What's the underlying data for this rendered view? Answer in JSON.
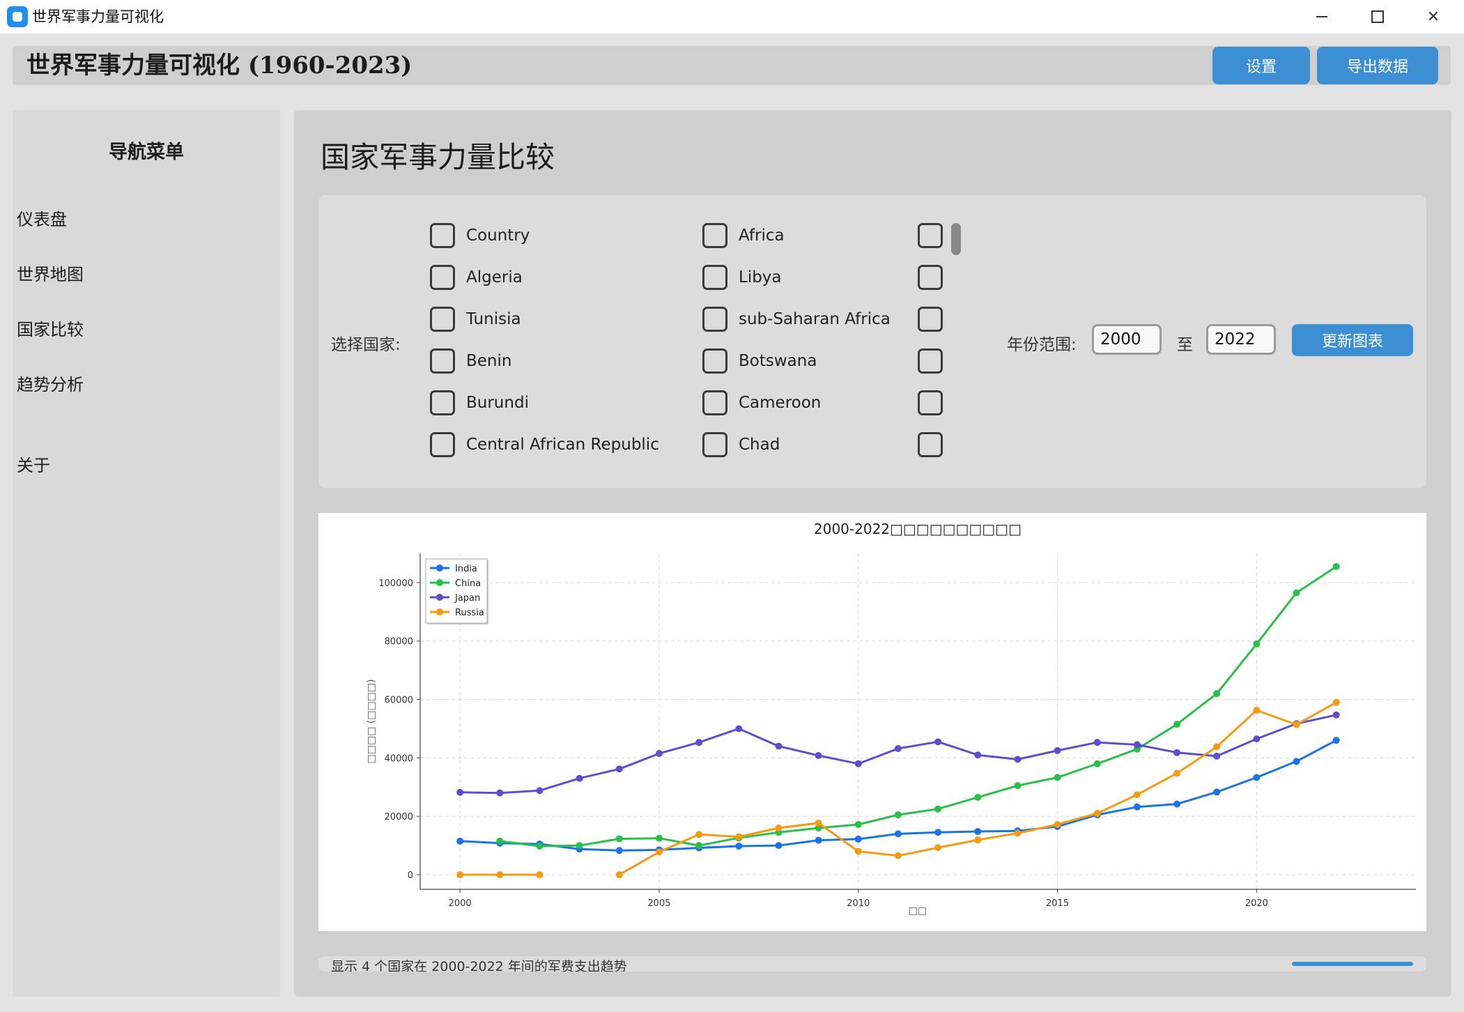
{
  "window": {
    "title": "世界军事力量可视化"
  },
  "header": {
    "title": "世界军事力量可视化 (1960-2023)",
    "settings_label": "设置",
    "export_label": "导出数据"
  },
  "sidebar": {
    "title": "导航菜单",
    "items": [
      {
        "label": "仪表盘"
      },
      {
        "label": "世界地图"
      },
      {
        "label": "国家比较"
      },
      {
        "label": "趋势分析"
      },
      {
        "label": "关于"
      }
    ]
  },
  "main": {
    "page_title": "国家军事力量比较",
    "select_label": "选择国家:",
    "countries_col1": [
      "Country",
      "Algeria",
      "Tunisia",
      "Benin",
      "Burundi",
      "Central African Republic"
    ],
    "countries_col2": [
      "Africa",
      "Libya",
      "sub-Saharan Africa",
      "Botswana",
      "Cameroon",
      "Chad"
    ],
    "countries_col3": [
      "",
      "",
      "",
      "",
      "",
      ""
    ],
    "year_label": "年份范围:",
    "year_from": "2000",
    "year_to_label": "至",
    "year_to": "2022",
    "update_label": "更新图表",
    "bottom_text": "显示 4 个国家在 2000-2022 年间的军费支出趋势",
    "progress": 1.0
  },
  "chart_data": {
    "type": "line",
    "title": "2000-2022□□□□□□□□□□",
    "xlabel": "□□",
    "ylabel": "□□□□ (□□□□)",
    "xlim": [
      1999.0,
      2024.0
    ],
    "ylim": [
      -5000,
      110000
    ],
    "xticks": [
      2000,
      2005,
      2010,
      2015,
      2020
    ],
    "yticks": [
      0,
      20000,
      40000,
      60000,
      80000,
      100000
    ],
    "grid": true,
    "legend": "top-left",
    "series": [
      {
        "name": "India",
        "color": "#1a73e8",
        "points": [
          [
            2000,
            11500
          ],
          [
            2001,
            10800
          ],
          [
            2002,
            10500
          ],
          [
            2003,
            8800
          ],
          [
            2004,
            8300
          ],
          [
            2005,
            8500
          ],
          [
            2006,
            9200
          ],
          [
            2007,
            9800
          ],
          [
            2008,
            10000
          ],
          [
            2009,
            11800
          ],
          [
            2010,
            12200
          ],
          [
            2011,
            14000
          ],
          [
            2012,
            14500
          ],
          [
            2013,
            14800
          ],
          [
            2014,
            15000
          ],
          [
            2015,
            16500
          ],
          [
            2016,
            20500
          ],
          [
            2017,
            23200
          ],
          [
            2018,
            24200
          ],
          [
            2019,
            28300
          ],
          [
            2020,
            33300
          ],
          [
            2021,
            38800
          ],
          [
            2022,
            46000
          ]
        ]
      },
      {
        "name": "China",
        "color": "#28c04a",
        "points": [
          [
            2001,
            11500
          ],
          [
            2002,
            9800
          ],
          [
            2003,
            10000
          ],
          [
            2004,
            12300
          ],
          [
            2005,
            12500
          ],
          [
            2006,
            10000
          ],
          [
            2007,
            12600
          ],
          [
            2008,
            14500
          ],
          [
            2009,
            16000
          ],
          [
            2010,
            17200
          ],
          [
            2011,
            20500
          ],
          [
            2012,
            22500
          ],
          [
            2013,
            26500
          ],
          [
            2014,
            30500
          ],
          [
            2015,
            33300
          ],
          [
            2016,
            38000
          ],
          [
            2017,
            43000
          ],
          [
            2018,
            51500
          ],
          [
            2019,
            62000
          ],
          [
            2020,
            79000
          ],
          [
            2021,
            96500
          ],
          [
            2022,
            105500
          ]
        ]
      },
      {
        "name": "Japan",
        "color": "#5b4fd0",
        "points": [
          [
            2000,
            28200
          ],
          [
            2001,
            28000
          ],
          [
            2002,
            28800
          ],
          [
            2003,
            33000
          ],
          [
            2004,
            36200
          ],
          [
            2005,
            41500
          ],
          [
            2006,
            45300
          ],
          [
            2007,
            50000
          ],
          [
            2008,
            44000
          ],
          [
            2009,
            40800
          ],
          [
            2010,
            38000
          ],
          [
            2011,
            43200
          ],
          [
            2012,
            45500
          ],
          [
            2013,
            41000
          ],
          [
            2014,
            39500
          ],
          [
            2015,
            42500
          ],
          [
            2016,
            45300
          ],
          [
            2017,
            44500
          ],
          [
            2018,
            41800
          ],
          [
            2019,
            40600
          ],
          [
            2020,
            46500
          ],
          [
            2021,
            51700
          ],
          [
            2022,
            54700
          ]
        ]
      },
      {
        "name": "Russia",
        "color": "#f59a12",
        "segments": [
          [
            [
              2000,
              0
            ],
            [
              2001,
              0
            ],
            [
              2002,
              0
            ]
          ],
          [
            [
              2004,
              0
            ],
            [
              2005,
              7800
            ],
            [
              2006,
              13800
            ],
            [
              2007,
              13000
            ],
            [
              2008,
              16000
            ],
            [
              2009,
              17700
            ],
            [
              2010,
              8000
            ],
            [
              2011,
              6500
            ],
            [
              2012,
              9300
            ],
            [
              2013,
              11900
            ],
            [
              2014,
              14200
            ],
            [
              2015,
              17200
            ],
            [
              2016,
              21000
            ],
            [
              2017,
              27400
            ],
            [
              2018,
              34700
            ],
            [
              2019,
              43800
            ],
            [
              2020,
              56300
            ],
            [
              2021,
              51400
            ],
            [
              2022,
              59000
            ]
          ]
        ]
      }
    ]
  }
}
